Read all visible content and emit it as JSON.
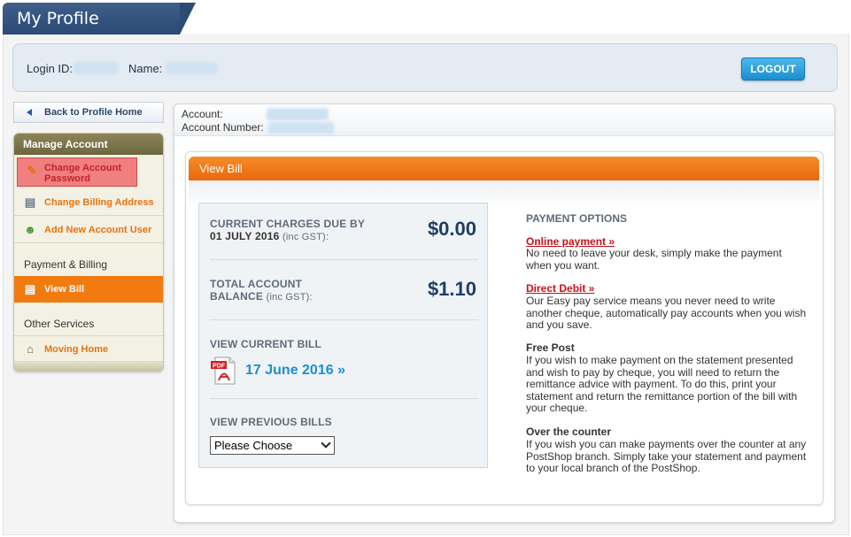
{
  "header": {
    "title": "My Profile"
  },
  "login": {
    "login_id_label": "Login ID:",
    "name_label": "Name:",
    "logout_label": "LOGOUT"
  },
  "sidebar": {
    "back_label": "Back to Profile Home",
    "section_title": "Manage Account",
    "items": [
      {
        "label_line1": "Change Account",
        "label_line2": "Password",
        "icon": "key-icon"
      },
      {
        "label": "Change Billing Address",
        "icon": "address-card-icon"
      },
      {
        "label": "Add New Account User",
        "icon": "add-user-icon"
      }
    ],
    "payment_section": "Payment & Billing",
    "view_bill": "View Bill",
    "other_section": "Other Services",
    "moving_home": "Moving Home"
  },
  "account": {
    "account_label": "Account:",
    "account_number_label": "Account Number:"
  },
  "bill": {
    "title": "View Bill",
    "current_label": "CURRENT CHARGES DUE BY",
    "current_date": "01 JULY 2016",
    "current_suffix": "(inc GST):",
    "current_amount": "$0.00",
    "total_label": "TOTAL ACCOUNT",
    "total_label2": "BALANCE",
    "total_suffix": "(inc GST):",
    "total_amount": "$1.10",
    "view_current_label": "VIEW CURRENT BILL",
    "current_bill_link": "17 June 2016 »",
    "view_previous_label": "VIEW PREVIOUS BILLS",
    "previous_select": "Please Choose"
  },
  "payment": {
    "heading": "PAYMENT OPTIONS",
    "online_link": "Online payment »",
    "online_text": "No need to leave your desk, simply make the payment when you want.",
    "debit_link": "Direct Debit »",
    "debit_text": "Our Easy pay service means you never need to write another cheque, automatically pay accounts when you wish and you save.",
    "freepost_title": "Free Post",
    "freepost_text": "If you wish to make payment on the statement presented and wish to pay by cheque, you will need to return the remittance advice with payment. To do this, print your statement and return the remittance portion of the bill with your cheque.",
    "counter_title": "Over the counter",
    "counter_text": "If you wish you can make payments over the counter at any PostShop branch. Simply take your statement and payment to your local branch of the PostShop."
  }
}
